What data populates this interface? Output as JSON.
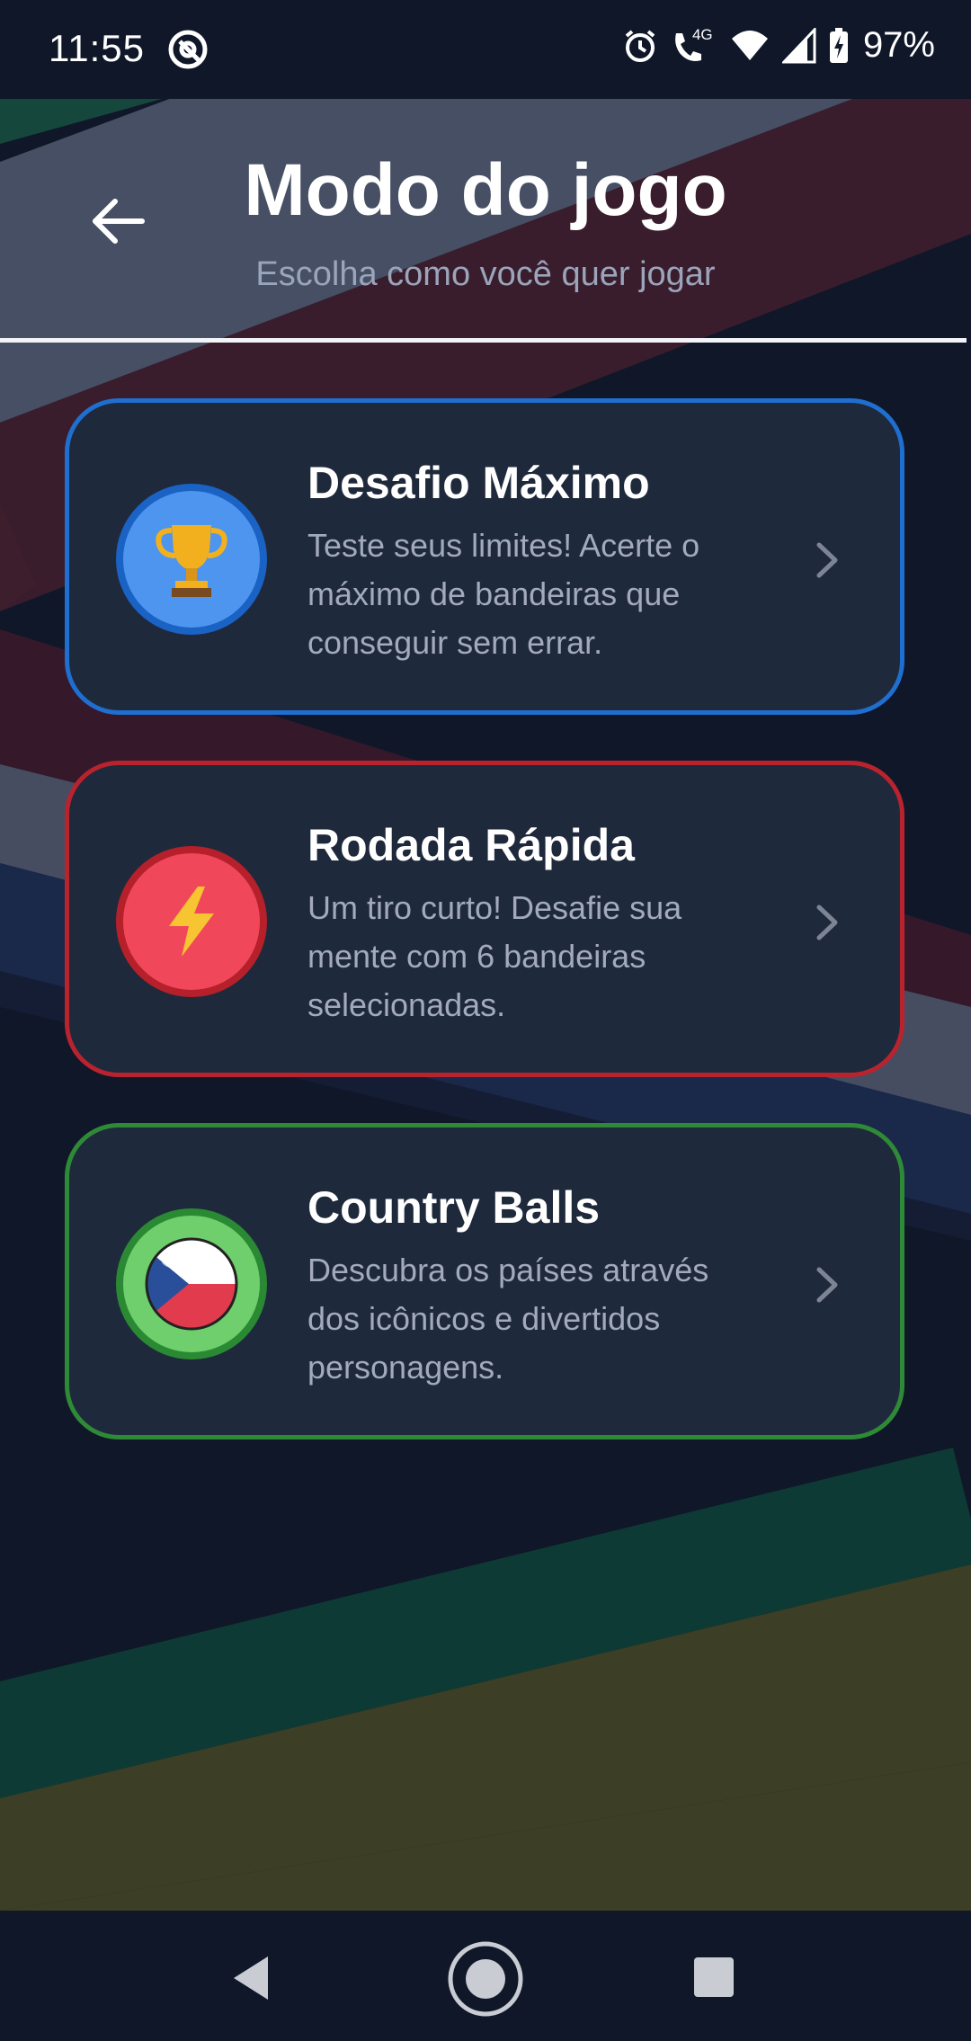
{
  "status_bar": {
    "time": "11:55",
    "network": "4G",
    "battery": "97%",
    "icons": [
      "at-sign-icon",
      "alarm-icon",
      "wifi-call-icon",
      "wifi-icon",
      "signal-icon",
      "battery-charging-icon"
    ]
  },
  "header": {
    "title": "Modo do jogo",
    "subtitle": "Escolha como você quer jogar",
    "back_icon": "arrow-left-icon"
  },
  "modes": [
    {
      "title": "Desafio Máximo",
      "description": "Teste seus limites! Acerte o máximo de bandeiras que conseguir sem errar.",
      "icon": "trophy-icon",
      "border_color": "#1f6fd1",
      "icon_bg": "#4e95ef",
      "icon_ring": "#1a62c4"
    },
    {
      "title": "Rodada Rápida",
      "description": "Um tiro curto! Desafie sua mente com 6 bandeiras selecionadas.",
      "icon": "lightning-icon",
      "border_color": "#b9232e",
      "icon_bg": "#f0485a",
      "icon_ring": "#b5202a"
    },
    {
      "title": "Country Balls",
      "description": "Descubra os países através dos icônicos e divertidos personagens.",
      "icon": "country-ball-icon",
      "border_color": "#2e8a36",
      "icon_bg": "#6fcf6c",
      "icon_ring": "#2a8a34"
    }
  ],
  "nav_bar": {
    "back": "nav-back-icon",
    "home": "nav-home-icon",
    "recents": "nav-recents-icon"
  }
}
